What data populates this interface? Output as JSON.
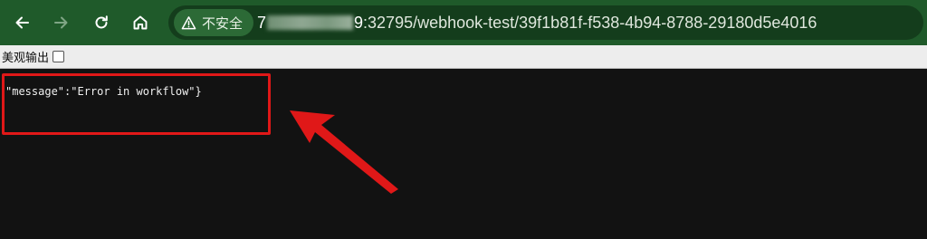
{
  "browser": {
    "url": {
      "host_start": "7",
      "host_end": "9",
      "rest": ":32795/webhook-test/39f1b81f-f538-4b94-8788-29180d5e4016"
    },
    "security_label": "不安全"
  },
  "pretty_print": {
    "label": "美观输出",
    "checked": false
  },
  "content": {
    "json_text": "\"message\":\"Error in workflow\"}"
  },
  "colors": {
    "toolbar": "#1f5a2a",
    "omnibox": "#143d1c",
    "annotation": "#e01818",
    "page_background": "#121212"
  }
}
